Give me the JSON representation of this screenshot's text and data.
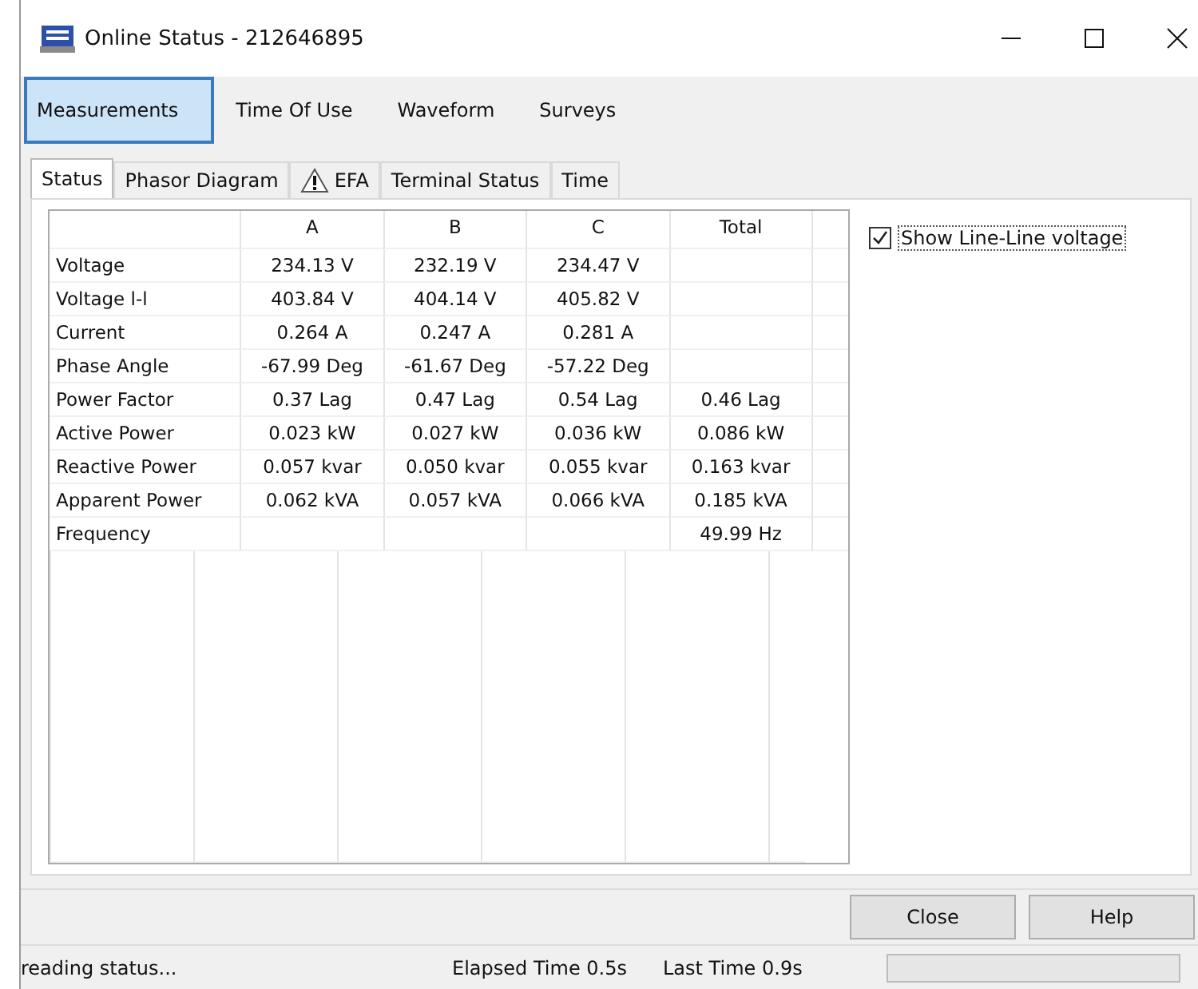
{
  "window": {
    "title": "Online Status - 212646895"
  },
  "tabs": [
    {
      "label": "Measurements",
      "selected": true
    },
    {
      "label": "Time Of Use",
      "selected": false
    },
    {
      "label": "Waveform",
      "selected": false
    },
    {
      "label": "Surveys",
      "selected": false
    }
  ],
  "sub_tabs": [
    {
      "label": "Status",
      "selected": true,
      "warning": false
    },
    {
      "label": "Phasor Diagram",
      "selected": false,
      "warning": false
    },
    {
      "label": "EFA",
      "selected": false,
      "warning": true
    },
    {
      "label": "Terminal Status",
      "selected": false,
      "warning": false
    },
    {
      "label": "Time",
      "selected": false,
      "warning": false
    }
  ],
  "table": {
    "columns": [
      "",
      "A",
      "B",
      "C",
      "Total"
    ],
    "rows": [
      [
        "Voltage",
        "234.13 V",
        "232.19 V",
        "234.47 V",
        ""
      ],
      [
        "Voltage l-l",
        "403.84 V",
        "404.14 V",
        "405.82 V",
        ""
      ],
      [
        "Current",
        "0.264 A",
        "0.247 A",
        "0.281 A",
        ""
      ],
      [
        "Phase Angle",
        "-67.99 Deg",
        "-61.67 Deg",
        "-57.22 Deg",
        ""
      ],
      [
        "Power Factor",
        "0.37 Lag",
        "0.47 Lag",
        "0.54 Lag",
        "0.46 Lag"
      ],
      [
        "Active Power",
        "0.023 kW",
        "0.027 kW",
        "0.036 kW",
        "0.086 kW"
      ],
      [
        "Reactive Power",
        "0.057 kvar",
        "0.050 kvar",
        "0.055 kvar",
        "0.163 kvar"
      ],
      [
        "Apparent Power",
        "0.062 kVA",
        "0.057 kVA",
        "0.066 kVA",
        "0.185 kVA"
      ],
      [
        "Frequency",
        "",
        "",
        "",
        "49.99 Hz"
      ]
    ]
  },
  "show_line_line": {
    "label": "Show Line-Line voltage",
    "checked": true
  },
  "buttons": [
    "Close",
    "Help"
  ],
  "status_bar": {
    "message": "reading status...",
    "elapsed": "Elapsed Time 0.5s",
    "last": "Last Time 0.9s",
    "progress": {
      "level": 0
    }
  }
}
